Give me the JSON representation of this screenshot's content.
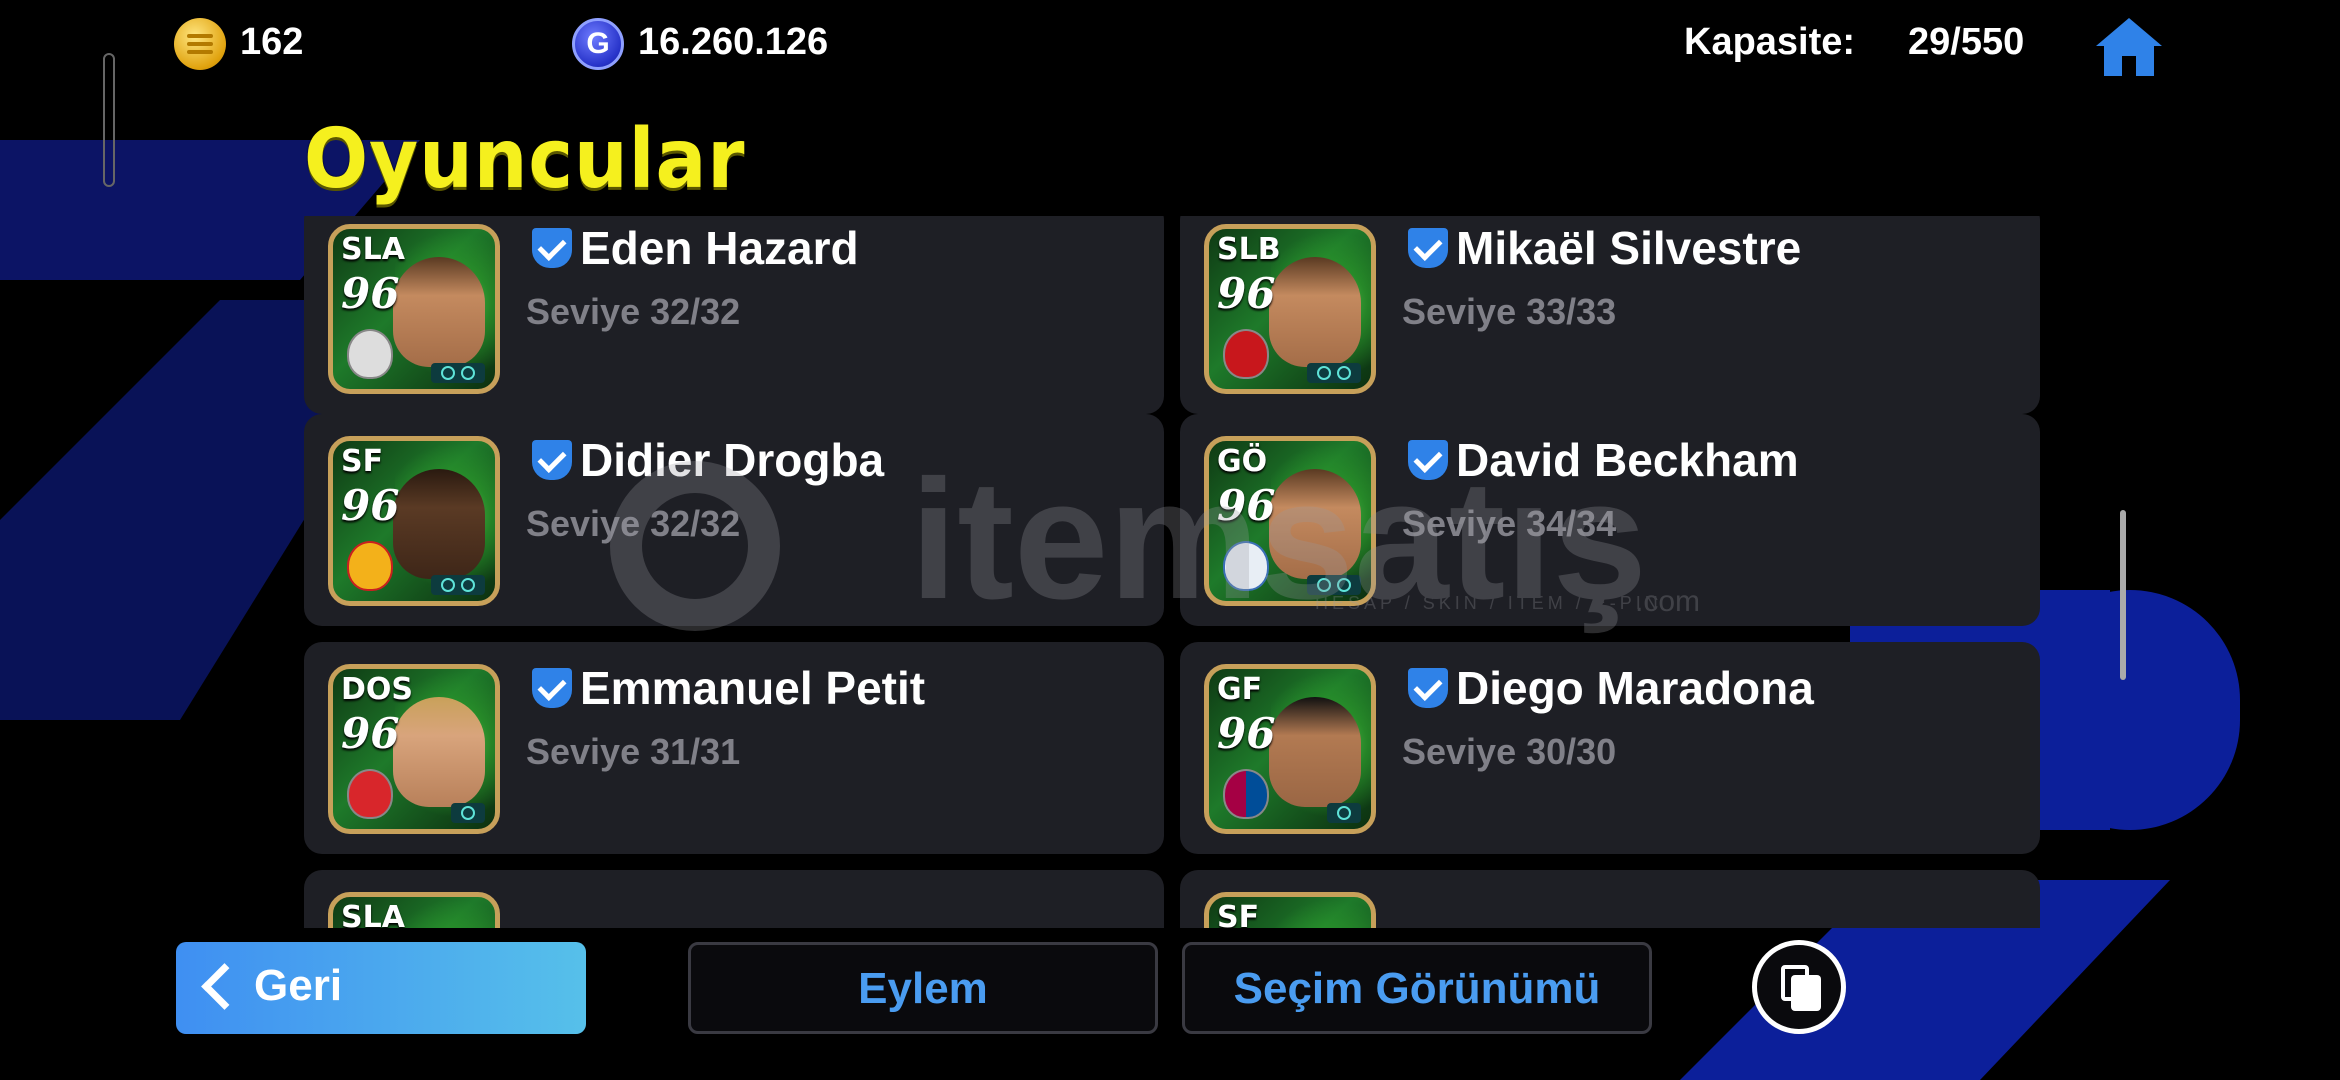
{
  "header": {
    "coins_value": "162",
    "gp_value": "16.260.126",
    "gp_icon_letter": "G",
    "capacity_label": "Kapasite:",
    "capacity_value": "29/550"
  },
  "page_title": "Oyuncular",
  "players": [
    {
      "name": "Eden Hazard",
      "position": "SLA",
      "rating": "96",
      "level": "Seviye 32/32"
    },
    {
      "name": "Mikaël Silvestre",
      "position": "SLB",
      "rating": "96",
      "level": "Seviye 33/33"
    },
    {
      "name": "Didier Drogba",
      "position": "SF",
      "rating": "96",
      "level": "Seviye 32/32"
    },
    {
      "name": "David Beckham",
      "position": "GÖ",
      "rating": "96",
      "level": "Seviye 34/34"
    },
    {
      "name": "Emmanuel Petit",
      "position": "DOS",
      "rating": "96",
      "level": "Seviye 31/31"
    },
    {
      "name": "Diego Maradona",
      "position": "GF",
      "rating": "96",
      "level": "Seviye 30/30"
    },
    {
      "name": "",
      "position": "SLA",
      "rating": "",
      "level": ""
    },
    {
      "name": "",
      "position": "SF",
      "rating": "",
      "level": ""
    }
  ],
  "watermark": {
    "text": "itemsatış",
    "subtext": "HESAP / SKIN / ITEM / E-PIN",
    "domain": ".com"
  },
  "footer": {
    "back_label": "Geri",
    "action_label": "Eylem",
    "selection_view_label": "Seçim Görünümü"
  },
  "colors": {
    "title_yellow": "#f5f01e",
    "accent_blue": "#2f82e8",
    "card_bg": "#1e1f25",
    "background": "#000000"
  },
  "icons": {
    "coin": "gold-coin-icon",
    "gp": "gp-coin-icon",
    "home": "home-icon",
    "verified": "verified-shield-icon",
    "back": "chevron-left-icon",
    "copy": "copy-icon"
  }
}
